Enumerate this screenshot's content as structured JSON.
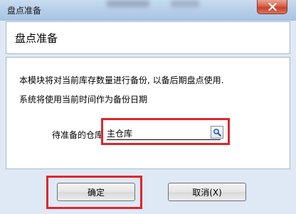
{
  "window": {
    "title": "盘点准备"
  },
  "header": {
    "heading": "盘点准备"
  },
  "content": {
    "description_line1": "本模块将对当前库存数量进行备份, 以备后期盘点使用.",
    "description_line2": "系统将使用当前时间作为备份日期",
    "warehouse_label": "待准备的仓库",
    "warehouse_value": "主仓库"
  },
  "buttons": {
    "ok_label": "确定",
    "cancel_label": "取消(X)"
  },
  "colors": {
    "highlight": "#e0262b",
    "titlebar": "#b9d0ea",
    "close_button": "#d7624a"
  },
  "icons": {
    "close": "close-icon",
    "lookup": "magnifier-icon"
  }
}
